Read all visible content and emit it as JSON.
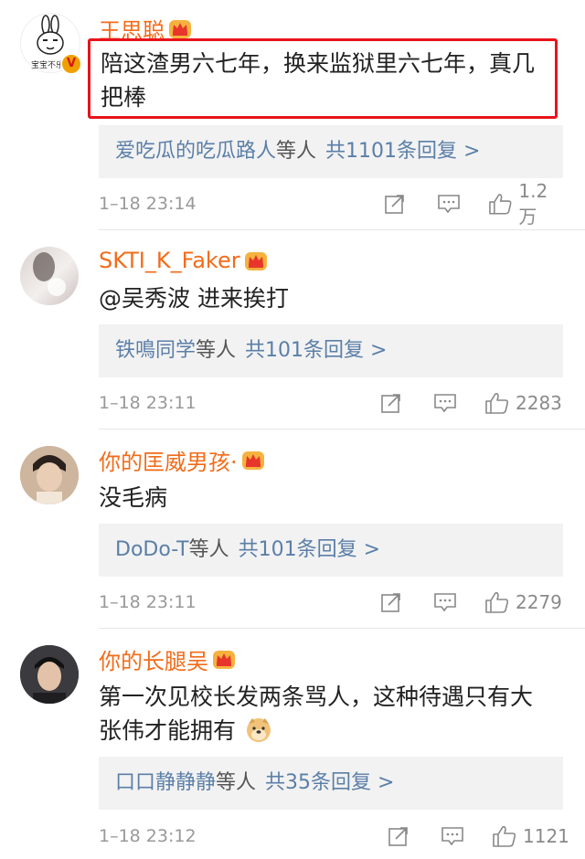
{
  "comments": [
    {
      "username": "王思聪",
      "avatar_caption": "宝宝不乐",
      "text": "陪这渣男六七年，换来监狱里六七年，真几把棒",
      "reply_users": "爱吃瓜的吃瓜路人",
      "reply_etc": "等人",
      "reply_count": "共1101条回复 >",
      "time": "1–18 23:14",
      "likes": "1.2万",
      "verified": true
    },
    {
      "username": "SKTI_K_Faker",
      "text": "@吴秀波  进来挨打",
      "reply_users": "铁鳴同学",
      "reply_etc": "等人",
      "reply_count": "共101条回复 >",
      "time": "1–18 23:11",
      "likes": "2283"
    },
    {
      "username": "你的匡威男孩·",
      "text": "没毛病",
      "reply_users": "DoDo-T",
      "reply_etc": "等人",
      "reply_count": "共101条回复 >",
      "time": "1–18 23:11",
      "likes": "2279"
    },
    {
      "username": "你的长腿吴",
      "text": "第一次见校长发两条骂人，这种待遇只有大张伟才能拥有",
      "reply_users": "口口静静静",
      "reply_etc": "等人",
      "reply_count": "共35条回复 >",
      "time": "1–18 23:12",
      "likes": "1121"
    }
  ],
  "colors": {
    "username": "#f26c1a",
    "link": "#5b7fa8",
    "highlight_border": "#e8131b",
    "verified_badge": "#f0a000"
  },
  "icons": [
    "crown-icon",
    "share-icon",
    "comment-icon",
    "like-icon",
    "verified-icon",
    "doge-emoji"
  ]
}
